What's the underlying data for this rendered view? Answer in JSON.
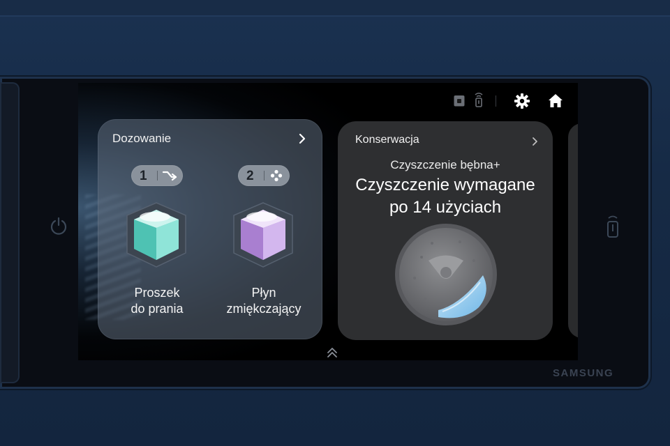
{
  "status_bar": {
    "icons": [
      "lock-icon",
      "remote-control-icon",
      "gear-icon",
      "home-icon"
    ]
  },
  "dosing_card": {
    "title": "Dozowanie",
    "compartments": [
      {
        "number": "1",
        "icon": "wash-arrow-icon",
        "label_line1": "Proszek",
        "label_line2": "do prania",
        "color": "#7fe6d6"
      },
      {
        "number": "2",
        "icon": "flower-icon",
        "label_line1": "Płyn",
        "label_line2": "zmiękczający",
        "color": "#c7a6e6"
      }
    ]
  },
  "maintenance_card": {
    "title": "Konserwacja",
    "subtitle": "Czyszczenie bębna+",
    "headline_line1": "Czyszczenie wymagane",
    "headline_line2": "po 14 użyciach"
  },
  "footer": {
    "icon": "double-chevron-up-icon"
  },
  "device": {
    "brand": "SAMSUNG"
  },
  "colors": {
    "accent_card": "#2e2f31",
    "screen_bg": "#000000",
    "panel": "#162a45"
  }
}
